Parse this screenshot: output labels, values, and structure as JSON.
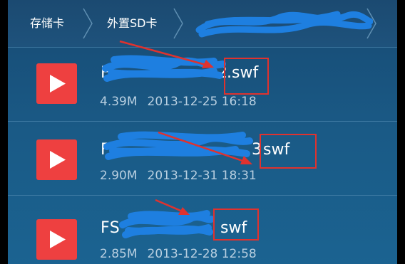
{
  "breadcrumb": {
    "items": [
      {
        "label": "存储卡"
      },
      {
        "label": "外置SD卡"
      },
      {
        "label": ""
      }
    ]
  },
  "files": [
    {
      "name_prefix": "F",
      "name_suffix": "2",
      "extension": ".swf",
      "size": "4.39M",
      "date": "2013-12-25 16:18"
    },
    {
      "name_prefix": "F",
      "name_suffix": "3",
      "extension": "swf",
      "size": "2.90M",
      "date": "2013-12-31 18:31"
    },
    {
      "name_prefix": "FS",
      "name_suffix": "",
      "extension": "swf",
      "size": "2.85M",
      "date": "2013-12-28 12:58"
    }
  ],
  "icons": {
    "play": "play-icon",
    "chevron": "chevron-right-icon"
  },
  "colors": {
    "play_button": "#ee4040",
    "annotation_red": "#e0322e",
    "redaction_blue": "#1e7fe0"
  }
}
